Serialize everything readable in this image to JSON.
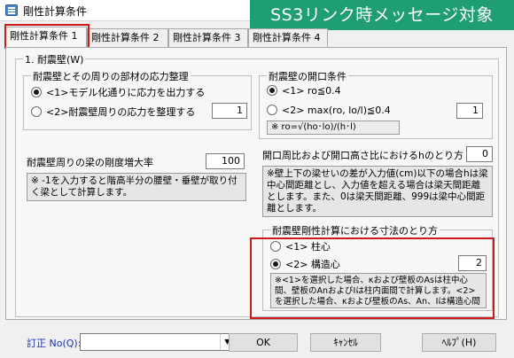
{
  "window": {
    "title": "剛性計算条件"
  },
  "banner": {
    "text": "SS3リンク時メッセージ対象"
  },
  "tabs": [
    {
      "label": "剛性計算条件 1"
    },
    {
      "label": "剛性計算条件 2"
    },
    {
      "label": "剛性計算条件 3"
    },
    {
      "label": "剛性計算条件 4"
    }
  ],
  "section": {
    "title": "1. 耐震壁(W)"
  },
  "stress_group": {
    "title": "耐震壁とその周りの部材の応力整理",
    "options": [
      "<1>モデル化通りに応力を出力する",
      "<2>耐震壁周りの応力を整理する"
    ],
    "selected": 0,
    "value": "1"
  },
  "opening_group": {
    "title": "耐震壁の開口条件",
    "options": [
      "<1> ro≦0.4",
      "<2> max(ro, lo/l)≦0.4"
    ],
    "selected": 0,
    "value": "1",
    "formula": "※ ro=√(ho･lo)/(h･l)"
  },
  "stiffness": {
    "label": "耐震壁周りの梁の剛度増大率",
    "value": "100",
    "note": "※ -1を入力すると階高半分の腰壁・垂壁が取り付く梁として計算します。"
  },
  "opening_height": {
    "label": "開口周比および開口高さ比におけるhのとり方",
    "value": "0",
    "note": "※壁上下の梁せいの差が入力値(cm)以下の場合hは梁中心間距離とし、入力値を超える場合は梁天間距離とします。また、0は梁天間距離、999は梁中心間距離とします。"
  },
  "dimension_group": {
    "title": "耐震壁剛性計算における寸法のとり方",
    "options": [
      "<1> 柱心",
      "<2> 構造心"
    ],
    "selected": 1,
    "value": "2",
    "note": "※<1>を選択した場合、κおよび壁板のAsは柱中心間、壁板のAnおよびIは柱内面間で計算します。<2>を選択した場合、κおよび壁板のAs、An、Iは構造心間で計算します。"
  },
  "footer": {
    "revision_label": "訂正 No(Q):",
    "revision_value": "",
    "ok_label": "OK",
    "cancel_label": "ｷｬﾝｾﾙ",
    "help_label": "ﾍﾙﾌﾟ(H)"
  },
  "colors": {
    "banner_bg": "#1e9e72",
    "highlight_border": "#cc1b1b",
    "panel_bg": "#f7f7f7",
    "dialog_bg": "#f0f0f0",
    "label_blue": "#1a2fb0"
  }
}
